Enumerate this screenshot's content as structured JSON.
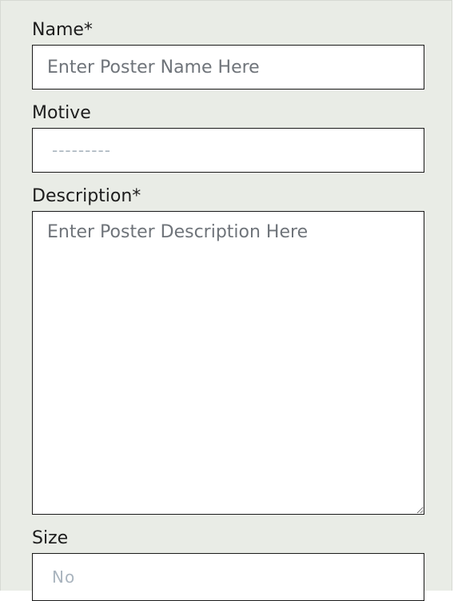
{
  "form": {
    "name": {
      "label": "Name*",
      "placeholder": "Enter Poster Name Here",
      "value": ""
    },
    "motive": {
      "label": "Motive",
      "selected": "---------"
    },
    "description": {
      "label": "Description*",
      "placeholder": "Enter Poster Description Here",
      "value": ""
    },
    "size": {
      "label": "Size",
      "selected": "No"
    }
  },
  "colors": {
    "panel_background": "#e9ece6",
    "field_border": "#1a1a1a",
    "placeholder_text": "#6f747a",
    "select_placeholder_text": "#a9b4be"
  }
}
